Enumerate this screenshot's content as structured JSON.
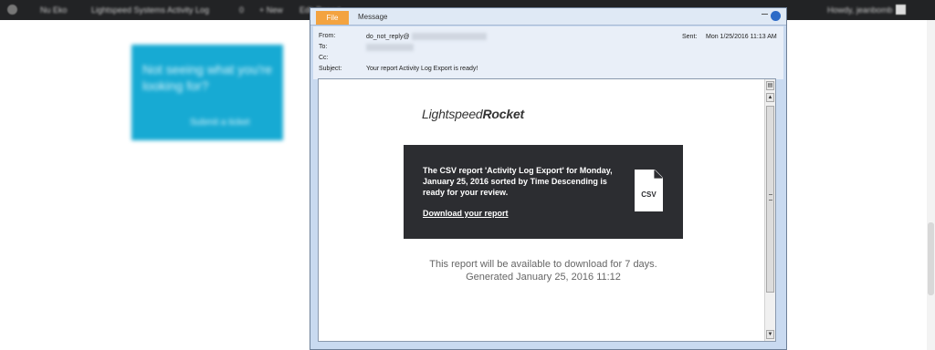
{
  "topbar": {
    "items": [
      "Nu Eko",
      "Lightspeed Systems Activity Log",
      "0",
      "+ New",
      "Edit Report"
    ],
    "user": "Howdy, jeanbomb"
  },
  "background_card": {
    "question": "Not seeing what you're looking for?",
    "link": "Submit a ticket"
  },
  "window": {
    "tabs": {
      "file": "File",
      "message": "Message"
    },
    "header": {
      "from_label": "From:",
      "from_value": "do_not_reply@",
      "to_label": "To:",
      "cc_label": "Cc:",
      "subject_label": "Subject:",
      "subject_value": "Your report Activity Log Export is ready!",
      "sent_label": "Sent:",
      "sent_value": "Mon 1/25/2016 11:13 AM"
    }
  },
  "email": {
    "logo_light": "Lightspeed",
    "logo_bold": "Rocket",
    "message": "The CSV report 'Activity Log Export' for Monday, January 25, 2016 sorted by Time Descending is ready for your review.",
    "download_link": "Download your report",
    "csv_label": "CSV",
    "availability": "This report will be available to download for 7 days.",
    "generated": "Generated January 25, 2016 11:12"
  }
}
